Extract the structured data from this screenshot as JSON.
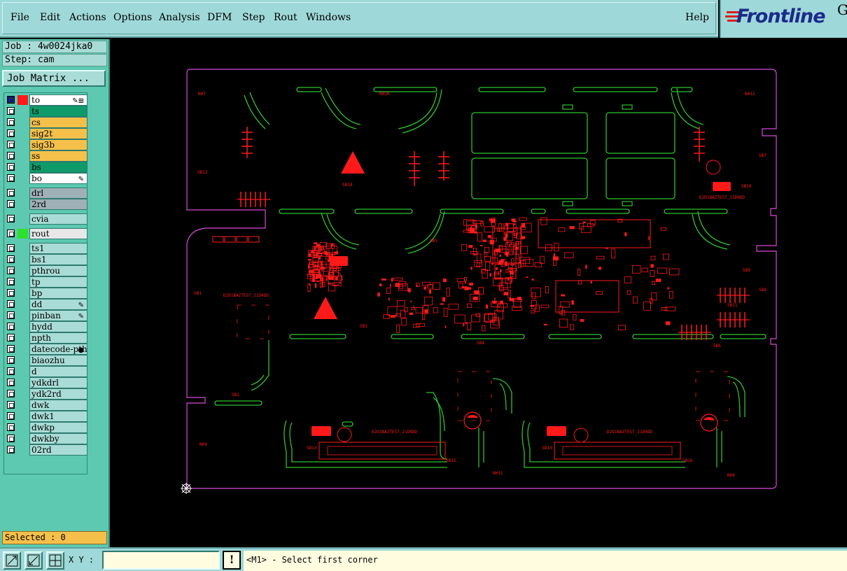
{
  "menu": {
    "items": [
      "File",
      "Edit",
      "Actions",
      "Options",
      "Analysis",
      "DFM",
      "Step",
      "Rout",
      "Windows"
    ],
    "help": "Help"
  },
  "logo": {
    "text": "Frontline",
    "corner": "G"
  },
  "job": {
    "label": "Job : 4w0024jka0",
    "step": "Step: cam"
  },
  "job_matrix_button": "Job Matrix ...",
  "layers": [
    {
      "name": "to",
      "color": "#ffffff",
      "swatch": "#ff1a1a",
      "marks": "✎⊞",
      "selected": true
    },
    {
      "name": "ts",
      "color": "#0f9a6a"
    },
    {
      "name": "cs",
      "color": "#f5c04a"
    },
    {
      "name": "sig2t",
      "color": "#f5c04a"
    },
    {
      "name": "sig3b",
      "color": "#f5c04a"
    },
    {
      "name": "ss",
      "color": "#f5c04a"
    },
    {
      "name": "bs",
      "color": "#0f9a6a"
    },
    {
      "name": "bo",
      "color": "#ffffff",
      "marks": "✎"
    },
    {
      "name": "drl",
      "color": "#9fb0b6"
    },
    {
      "name": "2rd",
      "color": "#9fb0b6"
    },
    {
      "name": "cvia",
      "color": "#a9dcd6"
    },
    {
      "name": "rout",
      "color": "#e8e8e8",
      "swatch": "#2ee02e"
    },
    {
      "name": "ts1",
      "color": "#a9dcd6"
    },
    {
      "name": "bs1",
      "color": "#a9dcd6"
    },
    {
      "name": "pthrou",
      "color": "#a9dcd6"
    },
    {
      "name": "tp",
      "color": "#a9dcd6"
    },
    {
      "name": "bp",
      "color": "#a9dcd6"
    },
    {
      "name": "dd",
      "color": "#a9dcd6",
      "marks": "✎"
    },
    {
      "name": "pinban",
      "color": "#a9dcd6",
      "marks": "✎"
    },
    {
      "name": "hydd",
      "color": "#a9dcd6"
    },
    {
      "name": "npth",
      "color": "#a9dcd6"
    },
    {
      "name": "datecode-pth",
      "color": "#a9dcd6",
      "marks": "●"
    },
    {
      "name": "biaozhu",
      "color": "#a9dcd6"
    },
    {
      "name": "d",
      "color": "#a9dcd6"
    },
    {
      "name": "ydkdrl",
      "color": "#a9dcd6"
    },
    {
      "name": "ydk2rd",
      "color": "#a9dcd6"
    },
    {
      "name": "dwk",
      "color": "#a9dcd6"
    },
    {
      "name": "dwk1",
      "color": "#a9dcd6"
    },
    {
      "name": "dwkp",
      "color": "#a9dcd6"
    },
    {
      "name": "dwkby",
      "color": "#a9dcd6"
    },
    {
      "name": "02rd",
      "color": "#a9dcd6"
    }
  ],
  "selected": "Selected : 0",
  "status": {
    "xy_label": "X Y :",
    "xy_value": "",
    "warn": "!",
    "prompt": "<M1> - Select first corner"
  },
  "board_labels": {
    "board_id": "D2D1BAZTEST_21D4DD",
    "ref_tags": [
      "SB1",
      "SB2",
      "SB3",
      "SB4",
      "SB5",
      "SB6",
      "SB7",
      "SB8",
      "SB9",
      "SB10",
      "SB11",
      "SB12",
      "SB13",
      "SB14",
      "SB15",
      "SB16",
      "SB18"
    ],
    "hole_tags": [
      "NH7",
      "NH8",
      "NH9",
      "NH10",
      "NH11",
      "NH12"
    ]
  },
  "colors": {
    "profile": "#d84ad8",
    "rout": "#2ec22e",
    "copper": "#ff1a1a"
  }
}
